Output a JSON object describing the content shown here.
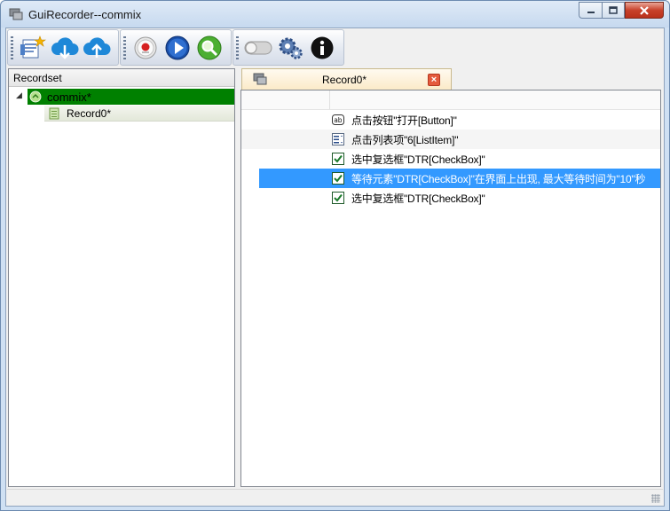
{
  "window": {
    "title": "GuiRecorder--commix"
  },
  "toolbar": {
    "groups": [
      [
        "new-record-icon",
        "download-cloud-icon",
        "upload-cloud-icon"
      ],
      [
        "record-icon",
        "play-icon",
        "inspect-icon"
      ],
      [
        "toggle-icon",
        "settings-icon",
        "info-icon"
      ]
    ]
  },
  "left_panel": {
    "header": "Recordset",
    "tree": {
      "root_label": "commix*",
      "child_label": "Record0*"
    }
  },
  "editor": {
    "tab_label": "Record0*",
    "tab_close": "×",
    "steps": [
      {
        "icon": "button-ab-icon",
        "text": "点击按钮\"打开[Button]\""
      },
      {
        "icon": "listitem-icon",
        "text": "点击列表项\"6[ListItem]\""
      },
      {
        "icon": "checkbox-icon",
        "text": "选中复选框\"DTR[CheckBox]\""
      },
      {
        "icon": "checkbox-icon",
        "text": "等待元素\"DTR[CheckBox]\"在界面上出现, 最大等待时间为\"10\"秒",
        "selected": true
      },
      {
        "icon": "checkbox-icon",
        "text": "选中复选框\"DTR[CheckBox]\""
      }
    ]
  },
  "colors": {
    "tree_root_bg": "#008000",
    "selection": "#3399ff",
    "tab_bg": "#fbeac8",
    "close_red": "#e45a3c"
  }
}
